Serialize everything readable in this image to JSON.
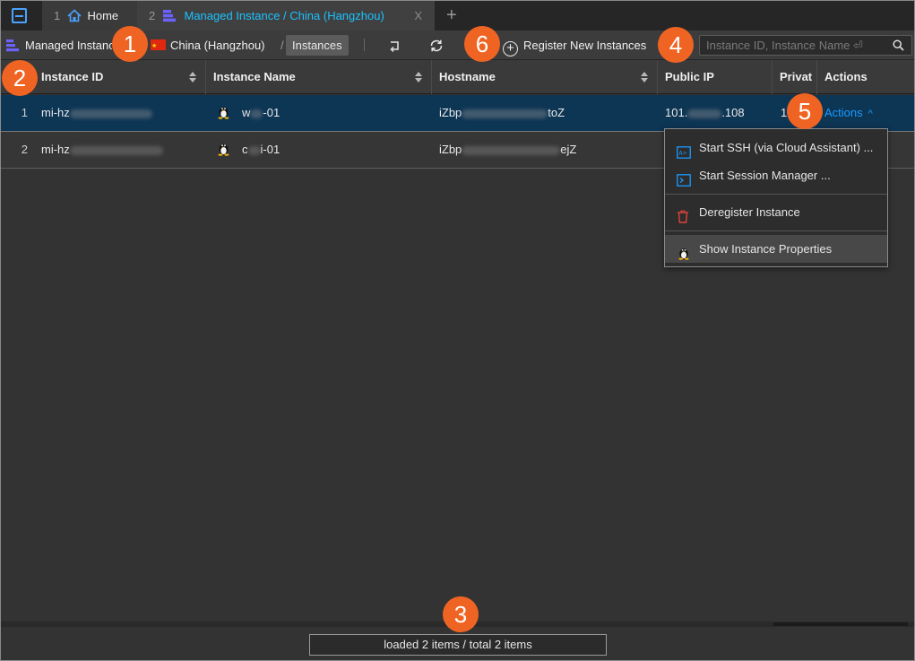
{
  "tabs": [
    {
      "num": "1",
      "label": "Home"
    },
    {
      "num": "2",
      "label": "Managed Instance / China (Hangzhou)",
      "close": "X"
    }
  ],
  "add_tab": "+",
  "toolbar": {
    "breadcrumb_root": "Managed Instances",
    "region": "China (Hangzhou)",
    "separator": "/",
    "current": "Instances",
    "register_label": "Register New Instances",
    "search_placeholder": "Instance ID, Instance Name ⏎"
  },
  "table": {
    "columns": [
      "Instance ID",
      "Instance Name",
      "Hostname",
      "Public IP",
      "Privat",
      "Actions"
    ],
    "rows": [
      {
        "idx": "1",
        "id_prefix": "mi-hz",
        "name_a": "w",
        "name_b": "-01",
        "host_a": "iZbp",
        "host_b": "toZ",
        "ip_a": "101.",
        "ip_b": ".108",
        "private_a": "1",
        "actions": "Actions",
        "actions_chevron": "^"
      },
      {
        "idx": "2",
        "id_prefix": "mi-hz",
        "name_a": "c",
        "name_b": "i-01",
        "host_a": "iZbp",
        "host_b": "ejZ"
      }
    ]
  },
  "actions_menu": [
    "Start SSH (via Cloud Assistant) ...",
    "Start Session Manager ...",
    "Deregister Instance",
    "Show Instance Properties"
  ],
  "footer": "loaded 2 items / total 2 items",
  "callouts": [
    "1",
    "2",
    "3",
    "4",
    "5",
    "6"
  ],
  "icons": {
    "app": "app-window-icon",
    "home": "home-icon",
    "managed_instance": "managed-instance-icon",
    "flag": "china-flag-icon",
    "back": "return-icon",
    "refresh": "refresh-icon",
    "add": "plus-circle-icon",
    "search": "search-icon",
    "linux": "linux-tux-icon",
    "ssh": "terminal-window-icon",
    "session": "console-icon",
    "trash": "trash-icon"
  },
  "colors": {
    "accent": "#19c2ff",
    "link": "#1a9bff",
    "selected_row": "#0d3554",
    "callout": "#f06423",
    "danger": "#e0433a"
  }
}
